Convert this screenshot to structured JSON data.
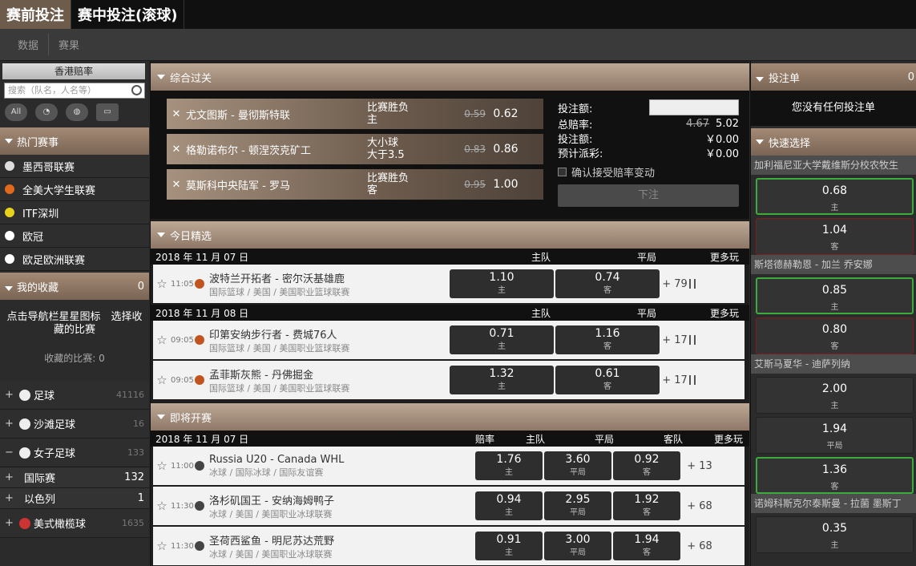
{
  "topbar": {
    "tabs": [
      {
        "label": "赛前投注"
      },
      {
        "label": "赛中投注(滚球)"
      }
    ]
  },
  "subbar": {
    "items": [
      "数据",
      "赛果"
    ]
  },
  "left": {
    "region": "香港赔率",
    "search_placeholder": "搜索（队名，人名等）",
    "filter_icons": [
      "All",
      "",
      "",
      ""
    ],
    "hot_title": "热门赛事",
    "hot_items": [
      {
        "label": "墨西哥联赛",
        "color": "#dddddd"
      },
      {
        "label": "全美大学生联赛",
        "color": "#e06a1b"
      },
      {
        "label": "ITF深圳",
        "color": "#e8d21c"
      },
      {
        "label": "欧冠",
        "color": "#ffffff"
      },
      {
        "label": "欧足欧洲联赛",
        "color": "#ffffff"
      }
    ],
    "fav_title": "我的收藏",
    "fav_count_badge": "0",
    "fav_hint": "点击导航栏星星图标　选择收藏的比赛",
    "fav_count_text": "收藏的比赛: 0",
    "sports": [
      {
        "pm": "+",
        "label": "足球",
        "count": "41116"
      },
      {
        "pm": "+",
        "label": "沙滩足球",
        "count": "16"
      },
      {
        "pm": "−",
        "label": "女子足球",
        "count": "133"
      }
    ],
    "subs": [
      {
        "pm": "+",
        "label": "国际赛",
        "count": "132"
      },
      {
        "pm": "+",
        "label": "以色列",
        "count": "1"
      }
    ],
    "sport_extra": {
      "pm": "+",
      "label": "美式橄榄球",
      "count": "1635"
    }
  },
  "combo": {
    "title": "综合过关",
    "rows": [
      {
        "match": "尤文图斯 - 曼彻斯特联",
        "market1": "比赛胜负",
        "market2": "主",
        "old": "0.59",
        "new": "0.62"
      },
      {
        "match": "格勒诺布尔 - 顿涅茨克矿工",
        "market1": "大小球",
        "market2": "大于3.5",
        "old": "0.83",
        "new": "0.86"
      },
      {
        "match": "莫斯科中央陆军 - 罗马",
        "market1": "比赛胜负",
        "market2": "客",
        "old": "0.95",
        "new": "1.00"
      }
    ],
    "slip": {
      "amount_label": "投注额:",
      "total_odds_label": "总赔率:",
      "total_odds_old": "4.67",
      "total_odds_new": "5.02",
      "stake_label": "投注额:",
      "stake_value": "￥0.00",
      "payout_label": "预计派彩:",
      "payout_value": "￥0.00",
      "accept_label": "确认接受赔率变动",
      "submit": "下注"
    }
  },
  "today": {
    "title": "今日精选",
    "groups": [
      {
        "date": "2018 年 11 月 07 日",
        "h_home": "主队",
        "h_draw": "平局",
        "h_more": "更多玩",
        "matches": [
          {
            "time": "11:05",
            "teams": "波特兰开拓者 - 密尔沃基雄鹿",
            "sub": "国际篮球 / 美国 / 美国职业篮球联赛",
            "o1": "1.10",
            "l1": "主",
            "o2": "0.74",
            "l2": "客",
            "more": "+ 79"
          }
        ]
      },
      {
        "date": "2018 年 11 月 08 日",
        "h_home": "主队",
        "h_draw": "平局",
        "h_more": "更多玩",
        "matches": [
          {
            "time": "09:05",
            "teams": "印第安纳步行者 - 费城76人",
            "sub": "国际篮球 / 美国 / 美国职业篮球联赛",
            "o1": "0.71",
            "l1": "主",
            "o2": "1.16",
            "l2": "客",
            "more": "+ 17"
          },
          {
            "time": "09:05",
            "teams": "孟菲斯灰熊 - 丹佛掘金",
            "sub": "国际篮球 / 美国 / 美国职业篮球联赛",
            "o1": "1.32",
            "l1": "主",
            "o2": "0.61",
            "l2": "客",
            "more": "+ 17"
          }
        ]
      }
    ]
  },
  "upcoming": {
    "title": "即将开赛",
    "date": "2018 年 11 月 07 日",
    "h_odds": "赔率",
    "h_home": "主队",
    "h_draw": "平局",
    "h_away": "客队",
    "h_more": "更多玩",
    "matches": [
      {
        "time": "11:00",
        "teams": "Russia U20 - Canada WHL",
        "sub": "冰球 / 国际冰球 / 国际友谊赛",
        "o1": "1.76",
        "l1": "主",
        "o2": "3.60",
        "l2": "平局",
        "o3": "0.92",
        "l3": "客",
        "more": "+ 13"
      },
      {
        "time": "11:30",
        "teams": "洛杉矶国王 - 安纳海姆鸭子",
        "sub": "冰球 / 美国 / 美国职业冰球联赛",
        "o1": "0.94",
        "l1": "主",
        "o2": "2.95",
        "l2": "平局",
        "o3": "1.92",
        "l3": "客",
        "more": "+ 68"
      },
      {
        "time": "11:30",
        "teams": "圣荷西鲨鱼 - 明尼苏达荒野",
        "sub": "冰球 / 美国 / 美国职业冰球联赛",
        "o1": "0.91",
        "l1": "主",
        "o2": "3.00",
        "l2": "平局",
        "o3": "1.94",
        "l3": "客",
        "more": "+ 68"
      }
    ]
  },
  "right": {
    "slip_title": "投注单",
    "slip_count": "0",
    "empty": "您没有任何投注单",
    "quick_title": "快速选择",
    "games": [
      {
        "title": "加利福尼亚大学戴维斯分校农牧生",
        "odds": [
          {
            "v": "0.68",
            "l": "主",
            "state": "hl"
          },
          {
            "v": "1.04",
            "l": "客",
            "state": "dn"
          }
        ]
      },
      {
        "title": "斯塔德赫勒恩 - 加兰 乔安娜",
        "odds": [
          {
            "v": "0.85",
            "l": "主",
            "state": "hl"
          },
          {
            "v": "0.80",
            "l": "客",
            "state": "dn"
          }
        ]
      },
      {
        "title": "艾斯马夏华 - 迪萨列纳",
        "odds": [
          {
            "v": "2.00",
            "l": "主",
            "state": ""
          },
          {
            "v": "1.94",
            "l": "平局",
            "state": ""
          },
          {
            "v": "1.36",
            "l": "客",
            "state": "hl"
          }
        ]
      },
      {
        "title": "诺姆科斯克尔泰斯曼 - 拉菌 墨斯丁",
        "odds": [
          {
            "v": "0.35",
            "l": "主",
            "state": ""
          }
        ]
      }
    ]
  }
}
